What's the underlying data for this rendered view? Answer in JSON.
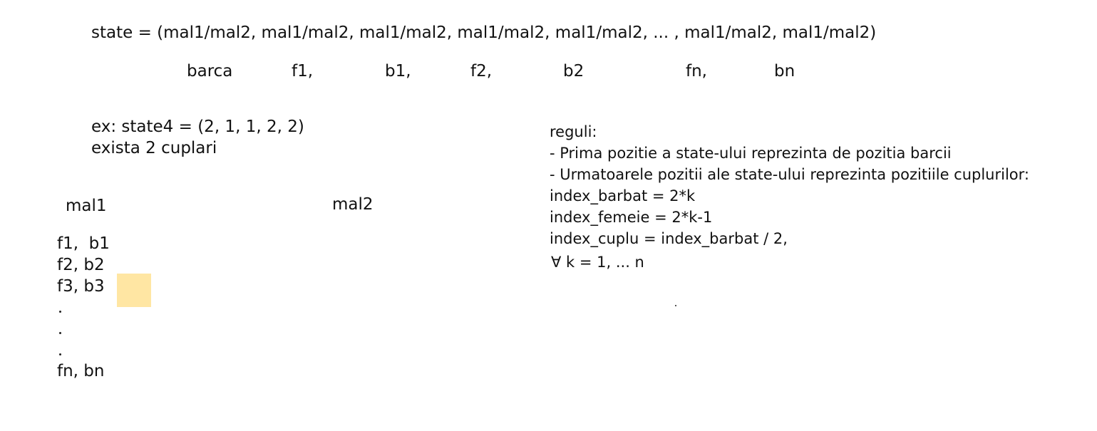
{
  "state_line": "state = (mal1/mal2, mal1/mal2, mal1/mal2, mal1/mal2, mal1/mal2, ... , mal1/mal2, mal1/mal2)",
  "position_labels": [
    "barca",
    "f1,",
    "b1,",
    "f2,",
    "b2",
    "fn,",
    "bn"
  ],
  "example": {
    "line1": "ex: state4 = (2, 1, 1, 2, 2)",
    "line2": "exista 2 cuplari"
  },
  "banks": {
    "left": "mal1",
    "right": "mal2"
  },
  "couples": [
    "f1,  b1",
    "f2, b2",
    "f3, b3",
    "fn, bn"
  ],
  "rules": {
    "title": "reguli:",
    "lines": [
      "- Prima pozitie a state-ului reprezinta de pozitia barcii",
      "- Urmatoarele pozitii ale state-ului reprezinta pozitiile cuplurilor:",
      "index_barbat = 2*k",
      "index_femeie = 2*k-1",
      "index_cuplu = index_barbat / 2,",
      "∀ k = 1, ... n"
    ]
  },
  "colors": {
    "sticky_note": "#ffe6a3",
    "ink": "#111111"
  }
}
